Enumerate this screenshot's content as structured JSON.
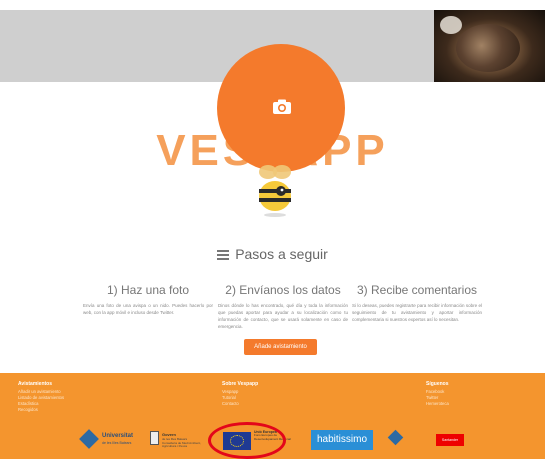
{
  "brand": {
    "name": "VESPAPP"
  },
  "camera": {
    "icon": "camera-icon"
  },
  "steps": {
    "heading": "Pasos a seguir",
    "heading_icon": "list-icon",
    "items": [
      {
        "title": "1) Haz una foto",
        "text": "Envía una foto de una avispa o un nido. Puedes hacerlo por web, con la app móvil e incluso desde Twitter."
      },
      {
        "title": "2) Envíanos los datos",
        "text": "Dinos dónde lo has encontrado, qué día y toda la información que puedas aportar para ayudar a su localización como tu información de contacto, que se usará solamente en caso de emergencia."
      },
      {
        "title": "3) Recibe comentarios",
        "text": "Si lo deseas, puedes registrarte para recibir información sobre el seguimiento de tu avistamiento y aportar información complementaria si nuestros expertos así lo necesitan."
      }
    ]
  },
  "add_button": {
    "label": "Añade avistamiento"
  },
  "footer": {
    "columns": [
      {
        "title": "Avistamientos",
        "links": [
          "Añadir un avistamiento",
          "Listado de avistamientos",
          "Estadística",
          "Recogidos"
        ]
      },
      {
        "title": "Sobre Vespapp",
        "links": [
          "Vespapp",
          "Tutorial",
          "Contacto"
        ]
      },
      {
        "title": "Síguenos",
        "links": [
          "Facebook",
          "Twitter",
          "Hemeroteca"
        ]
      }
    ],
    "logos": {
      "uib_name": "Universitat",
      "uib_sub": "de les Illes Balears",
      "govern_name": "Govern",
      "govern_sub": "de les Illes Balears",
      "govern_detail": "Conselleria de Medi Ambient, Agricultura i Pesca",
      "eu_title": "Unió Europea",
      "eu_detail": "Fons Europeu de Desenvolupament Regional",
      "habitissimo": "habitissimo",
      "santander": "Santander"
    }
  },
  "colors": {
    "accent": "#f47a2c",
    "footer": "#f4952e",
    "annotation": "#e3061a"
  }
}
